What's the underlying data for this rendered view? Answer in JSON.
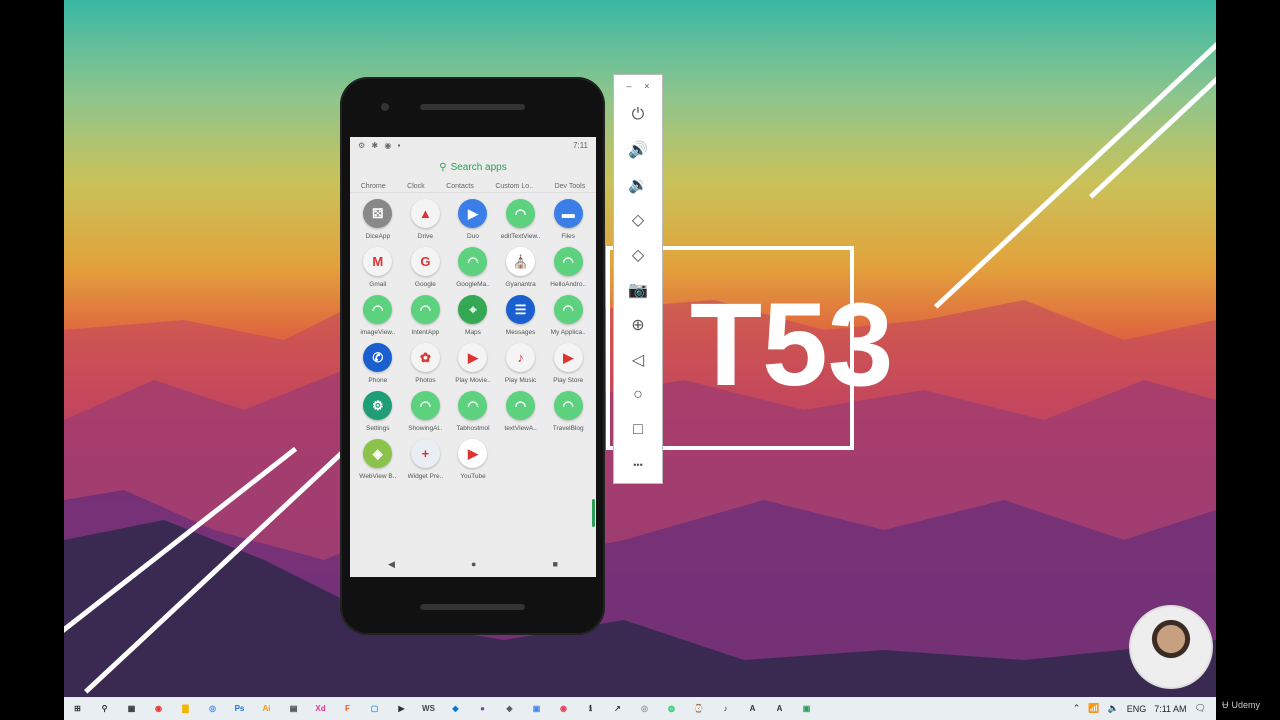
{
  "phone": {
    "status_time": "7:11",
    "search_placeholder": "Search apps",
    "top_row": [
      "Chrome",
      "Clock",
      "Contacts",
      "Custom Lo..",
      "Dev Tools"
    ],
    "apps": [
      {
        "label": "DiceApp",
        "icon": "dice-icon",
        "color": "#888888",
        "glyph": "⚄"
      },
      {
        "label": "Drive",
        "icon": "drive-icon",
        "color": "#f4f4f4",
        "glyph": "▲"
      },
      {
        "label": "Duo",
        "icon": "duo-icon",
        "color": "#3b7ee8",
        "glyph": "▶"
      },
      {
        "label": "editTextView..",
        "icon": "android-icon",
        "color": "#5cd27e",
        "glyph": "◠"
      },
      {
        "label": "Files",
        "icon": "files-icon",
        "color": "#3b7ee8",
        "glyph": "▬"
      },
      {
        "label": "Gmail",
        "icon": "gmail-icon",
        "color": "#f4f4f4",
        "glyph": "M"
      },
      {
        "label": "Google",
        "icon": "google-icon",
        "color": "#f4f4f4",
        "glyph": "G"
      },
      {
        "label": "GoogleMa..",
        "icon": "android-icon",
        "color": "#5cd27e",
        "glyph": "◠"
      },
      {
        "label": "Gyanantra",
        "icon": "gyanantra-icon",
        "color": "#ffffff",
        "glyph": "⛪"
      },
      {
        "label": "HelloAndro..",
        "icon": "android-icon",
        "color": "#5cd27e",
        "glyph": "◠"
      },
      {
        "label": "imageView..",
        "icon": "android-icon",
        "color": "#5cd27e",
        "glyph": "◠"
      },
      {
        "label": "IntentApp",
        "icon": "android-icon",
        "color": "#5cd27e",
        "glyph": "◠"
      },
      {
        "label": "Maps",
        "icon": "maps-icon",
        "color": "#34a853",
        "glyph": "⌖"
      },
      {
        "label": "Messages",
        "icon": "messages-icon",
        "color": "#1a5fd0",
        "glyph": "☰"
      },
      {
        "label": "My Applica..",
        "icon": "android-icon",
        "color": "#5cd27e",
        "glyph": "◠"
      },
      {
        "label": "Phone",
        "icon": "phone-icon",
        "color": "#1a5fd0",
        "glyph": "✆"
      },
      {
        "label": "Photos",
        "icon": "photos-icon",
        "color": "#f4f4f4",
        "glyph": "✿"
      },
      {
        "label": "Play Movie..",
        "icon": "play-movies-icon",
        "color": "#f4f4f4",
        "glyph": "▶"
      },
      {
        "label": "Play Music",
        "icon": "play-music-icon",
        "color": "#f4f4f4",
        "glyph": "♪"
      },
      {
        "label": "Play Store",
        "icon": "play-store-icon",
        "color": "#f4f4f4",
        "glyph": "▶"
      },
      {
        "label": "Settings",
        "icon": "settings-icon",
        "color": "#1f9d74",
        "glyph": "⚙"
      },
      {
        "label": "ShowingAl..",
        "icon": "android-icon",
        "color": "#5cd27e",
        "glyph": "◠"
      },
      {
        "label": "Tabhostmol",
        "icon": "android-icon",
        "color": "#5cd27e",
        "glyph": "◠"
      },
      {
        "label": "textViewA..",
        "icon": "android-icon",
        "color": "#5cd27e",
        "glyph": "◠"
      },
      {
        "label": "TravelBlog",
        "icon": "android-icon",
        "color": "#5cd27e",
        "glyph": "◠"
      },
      {
        "label": "WebView B..",
        "icon": "webview-icon",
        "color": "#8bc34a",
        "glyph": "◈"
      },
      {
        "label": "Widget Pre..",
        "icon": "widget-preview-icon",
        "color": "#e9eef5",
        "glyph": "+"
      },
      {
        "label": "YouTube",
        "icon": "youtube-icon",
        "color": "#ffffff",
        "glyph": "▶"
      }
    ],
    "nav": {
      "back": "◀",
      "home": "●",
      "recents": "■"
    }
  },
  "toolbar": {
    "minimize": "–",
    "close": "×",
    "buttons": [
      {
        "name": "power-icon",
        "glyph": "⏻"
      },
      {
        "name": "volume-up-icon",
        "glyph": "🔊"
      },
      {
        "name": "volume-down-icon",
        "glyph": "🔉"
      },
      {
        "name": "rotate-left-icon",
        "glyph": "◇"
      },
      {
        "name": "rotate-right-icon",
        "glyph": "◇"
      },
      {
        "name": "camera-icon",
        "glyph": "📷"
      },
      {
        "name": "zoom-icon",
        "glyph": "⊕"
      },
      {
        "name": "back-icon",
        "glyph": "◁"
      },
      {
        "name": "home-icon",
        "glyph": "○"
      },
      {
        "name": "overview-icon",
        "glyph": "□"
      },
      {
        "name": "more-icon",
        "glyph": "•••"
      }
    ]
  },
  "wallpaper": {
    "logo_text": "T53"
  },
  "branding": {
    "udemy": "Udemy"
  },
  "taskbar": {
    "apps": [
      "⊞",
      "⚲",
      "▦",
      "◉",
      "▇",
      "◎",
      "Ps",
      "Ai",
      "▤",
      "Xd",
      "F",
      "▢",
      "▶",
      "WS",
      "◆",
      "●",
      "◈",
      "▣",
      "◉",
      "ℹ",
      "↗",
      "◎",
      "◍",
      "⌚",
      "♪",
      "A",
      "A",
      "▣"
    ],
    "language": "ENG",
    "time": "7:11 AM"
  }
}
